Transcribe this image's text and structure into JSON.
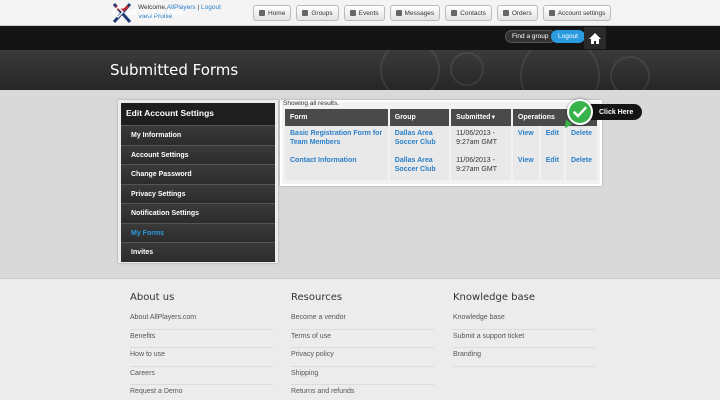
{
  "topbar": {
    "welcome_prefix": "Welcome,",
    "username": "AllPlayers",
    "separator": " | ",
    "logout_link": "Logout",
    "view_profile": "View Profile",
    "nav": [
      {
        "label": "Home",
        "icon": "home-icon"
      },
      {
        "label": "Groups",
        "icon": "groups-icon"
      },
      {
        "label": "Events",
        "icon": "calendar-icon"
      },
      {
        "label": "Messages",
        "icon": "mail-icon"
      },
      {
        "label": "Contacts",
        "icon": "contacts-icon"
      },
      {
        "label": "Orders",
        "icon": "cart-icon"
      },
      {
        "label": "Account settings",
        "icon": "shield-icon"
      }
    ]
  },
  "header": {
    "brand": "allplayers.com",
    "find_group": "Find a group",
    "logout": "Logout"
  },
  "page": {
    "title": "Submitted Forms"
  },
  "sidebar": {
    "title": "Edit Account Settings",
    "items": [
      {
        "label": "My Information",
        "active": false
      },
      {
        "label": "Account Settings",
        "active": false
      },
      {
        "label": "Change Password",
        "active": false
      },
      {
        "label": "Privacy Settings",
        "active": false
      },
      {
        "label": "Notification Settings",
        "active": false
      },
      {
        "label": "My Forms",
        "active": true
      },
      {
        "label": "Invites",
        "active": false
      }
    ]
  },
  "results": {
    "showing": "Showing all results.",
    "columns": [
      "Form",
      "Group",
      "Submitted",
      "Operations"
    ],
    "rows": [
      {
        "form": "Basic Registration Form for Team Members",
        "group": "Dallas Area Soccer Club",
        "submitted": "11/06/2013 - 9:27am GMT",
        "view": "View",
        "edit": "Edit",
        "delete": "Delete"
      },
      {
        "form": "Contact Information",
        "group": "Dallas Area Soccer Club",
        "submitted": "11/06/2013 - 9:27am GMT",
        "view": "View",
        "edit": "Edit",
        "delete": "Delete"
      }
    ]
  },
  "callout": {
    "label": "Click Here",
    "color": "#38b24a"
  },
  "footer": {
    "columns": [
      {
        "title": "About us",
        "links": [
          "About AllPlayers.com",
          "Benefits",
          "How to use",
          "Careers",
          "Request a Demo"
        ]
      },
      {
        "title": "Resources",
        "links": [
          "Become a vendor",
          "Terms of use",
          "Privacy policy",
          "Shipping",
          "Returns and refunds"
        ]
      },
      {
        "title": "Knowledge base",
        "links": [
          "Knowledge base",
          "Submit a support ticket",
          "Branding"
        ]
      }
    ]
  },
  "colors": {
    "accent": "#2b9be0",
    "link": "#2a7fc9",
    "dark": "#141414"
  }
}
